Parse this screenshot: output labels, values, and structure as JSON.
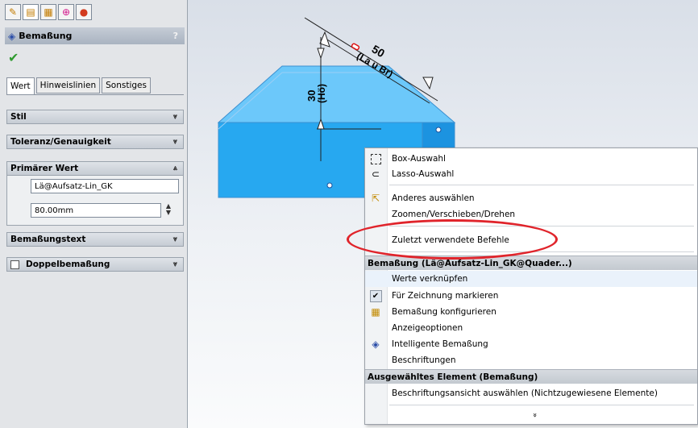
{
  "panel": {
    "tabstrip_icons": [
      "feature-manager-icon",
      "property-manager-icon",
      "configuration-manager-icon",
      "dimxpert-manager-icon",
      "display-manager-icon"
    ],
    "title": "Bemaßung",
    "help": "?",
    "ok": "✔",
    "subtabs": [
      "Wert",
      "Hinweislinien",
      "Sonstiges"
    ],
    "groups": {
      "stil": "Stil",
      "toleranz": "Toleranz/Genauigkeit",
      "primaer": "Primärer Wert",
      "bemassungstext": "Bemaßungstext",
      "doppel": "Doppelbemaßung"
    },
    "primary_name_value": "Lä@Aufsatz-Lin_GK",
    "primary_value": "80.00mm"
  },
  "viewport": {
    "dim_horizontal_value": "50",
    "dim_horizontal_label": "(Lä u Br)",
    "dim_vertical_value": "30",
    "dim_vertical_label": "(Hö)"
  },
  "menu": {
    "items_top": [
      {
        "label": "Box-Auswahl",
        "icon": "box-select-icon"
      },
      {
        "label": "Lasso-Auswahl",
        "icon": "lasso-select-icon"
      },
      {
        "label": "Anderes auswählen",
        "icon": "select-other-icon"
      },
      {
        "label": "Zoomen/Verschieben/Drehen",
        "icon": ""
      },
      {
        "label": "Zuletzt verwendete Befehle",
        "icon": ""
      }
    ],
    "section_dimension": "Bemaßung (Lä@Aufsatz-Lin_GK@Quader...)",
    "items_dimension": [
      {
        "label": "Werte verknüpfen",
        "icon": ""
      },
      {
        "label": "Für Zeichnung markieren",
        "icon": "checkbox-checked-icon"
      },
      {
        "label": "Bemaßung konfigurieren",
        "icon": "configure-dimension-icon"
      },
      {
        "label": "Anzeigeoptionen",
        "icon": ""
      },
      {
        "label": "Intelligente Bemaßung",
        "icon": "smart-dimension-icon"
      },
      {
        "label": "Beschriftungen",
        "icon": ""
      }
    ],
    "section_selected": "Ausgewähltes Element (Bemaßung)",
    "items_selected": [
      {
        "label": "Beschriftungsansicht auswählen (Nichtzugewiesene Elemente)",
        "icon": ""
      }
    ],
    "more": "»"
  },
  "colors": {
    "model_front": "#27a8f0",
    "model_top": "#6cc8fa",
    "highlight_ellipse": "#e0242b"
  }
}
